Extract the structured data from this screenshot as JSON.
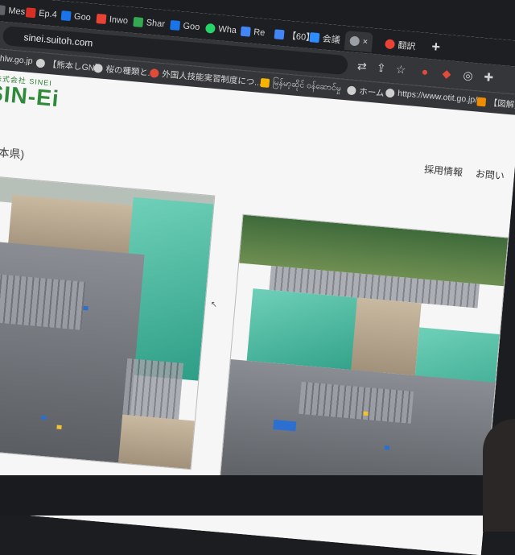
{
  "browser": {
    "tabs": [
      {
        "label": "Mes",
        "color": "#5f6368"
      },
      {
        "label": "Ep.4",
        "color": "#d93025"
      },
      {
        "label": "Goo",
        "color": "#1a73e8"
      },
      {
        "label": "Inwo",
        "color": "#ea4335"
      },
      {
        "label": "Shar",
        "color": "#34a853"
      },
      {
        "label": "Goo",
        "color": "#1a73e8"
      },
      {
        "label": "Wha",
        "color": "#25d366"
      },
      {
        "label": "Re",
        "color": "#4285f4"
      },
      {
        "label": "【60】",
        "color": "#4285f4"
      },
      {
        "label": "会議",
        "color": "#2d8cff"
      },
      {
        "label": "",
        "color": "#9aa0a6"
      },
      {
        "label": "翻訳",
        "color": "#ea4335"
      }
    ],
    "new_tab": "+",
    "url": "sinei.suitoh.com",
    "bookmarks": [
      {
        "label": "mhlw.go.jp"
      },
      {
        "label": "【熊本しGN】"
      },
      {
        "label": "桜の種類と..."
      },
      {
        "label": "外国人技能実習制度につ..."
      },
      {
        "label": "မြန်မာ့ဆိုင် ဝန်ဆောင်မှု"
      },
      {
        "label": "ホーム"
      },
      {
        "label": "https://www.otit.go.jp/"
      },
      {
        "label": "【図解】よくわかる年金の仕..."
      }
    ]
  },
  "site": {
    "logo_small": "株式会社 SINEI",
    "logo": "SIN-Ei",
    "nav": [
      "採用情報",
      "お問い"
    ],
    "location": "(熊本県)"
  },
  "colors": {
    "accent": "#2f8a3a",
    "browser_chrome": "#35363a"
  }
}
